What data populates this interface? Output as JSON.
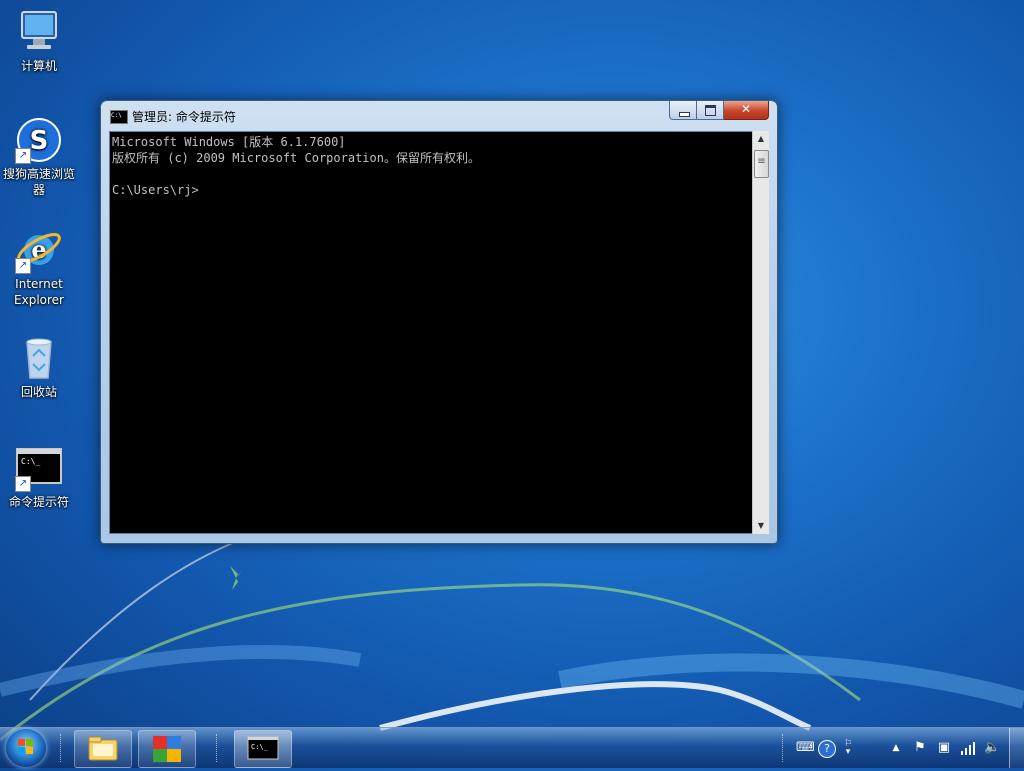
{
  "desktop": {
    "icons": [
      {
        "label": "计算机",
        "icon": "computer-icon"
      },
      {
        "label": "搜狗高速浏览器",
        "icon": "sogou-browser-icon"
      },
      {
        "label": "Internet Explorer",
        "icon": "internet-explorer-icon"
      },
      {
        "label": "回收站",
        "icon": "recycle-bin-icon"
      },
      {
        "label": "命令提示符",
        "icon": "command-prompt-icon"
      }
    ]
  },
  "window": {
    "title": "管理员: 命令提示符",
    "console_lines": [
      "Microsoft Windows [版本 6.1.7600]",
      "版权所有 (c) 2009 Microsoft Corporation。保留所有权利。",
      "",
      "C:\\Users\\rj>"
    ],
    "title_icon_text": "C:\\",
    "buttons": {
      "minimize": "minimize",
      "maximize": "maximize",
      "close": "close"
    }
  },
  "taskbar": {
    "start_icon": "windows-start-icon",
    "pinned": [
      {
        "name": "windows-explorer-icon"
      },
      {
        "name": "puzzle-app-icon"
      },
      {
        "name": "command-prompt-icon",
        "text": "C:\\_"
      }
    ],
    "tray": [
      "keyboard-icon",
      "help-icon",
      "ime-options-icon",
      "show-hidden-icons",
      "action-center-flag-icon",
      "safely-remove-hardware-icon",
      "network-signal-icon",
      "volume-icon"
    ]
  },
  "colors": {
    "console_bg": "#000000",
    "console_text": "#c0c0c0",
    "close_button": "#c9452c"
  }
}
